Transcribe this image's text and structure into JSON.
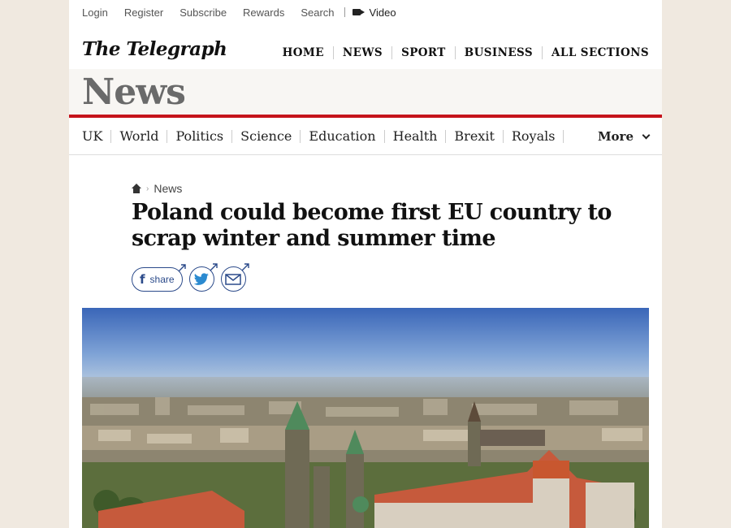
{
  "utility": {
    "links": [
      "Login",
      "Register",
      "Subscribe",
      "Rewards",
      "Search"
    ],
    "video_label": "Video"
  },
  "masthead": {
    "logo": "The Telegraph",
    "nav": [
      "HOME",
      "NEWS",
      "SPORT",
      "BUSINESS",
      "ALL SECTIONS"
    ]
  },
  "section": {
    "title": "News"
  },
  "subnav": {
    "items": [
      "UK",
      "World",
      "Politics",
      "Science",
      "Education",
      "Health",
      "Brexit",
      "Royals"
    ],
    "more_label": "More"
  },
  "article": {
    "breadcrumb": "News",
    "headline": "Poland could become first EU country to scrap winter and summer time",
    "share_label": "share"
  },
  "icons": [
    "home-icon",
    "facebook-icon",
    "twitter-icon",
    "email-icon",
    "video-camera-icon",
    "chevron-down-icon"
  ],
  "colors": {
    "accent_red": "#c6131b",
    "share_blue": "#2b4a8a",
    "section_gray": "#6a6a6a",
    "page_bg": "#f0e9e0"
  }
}
